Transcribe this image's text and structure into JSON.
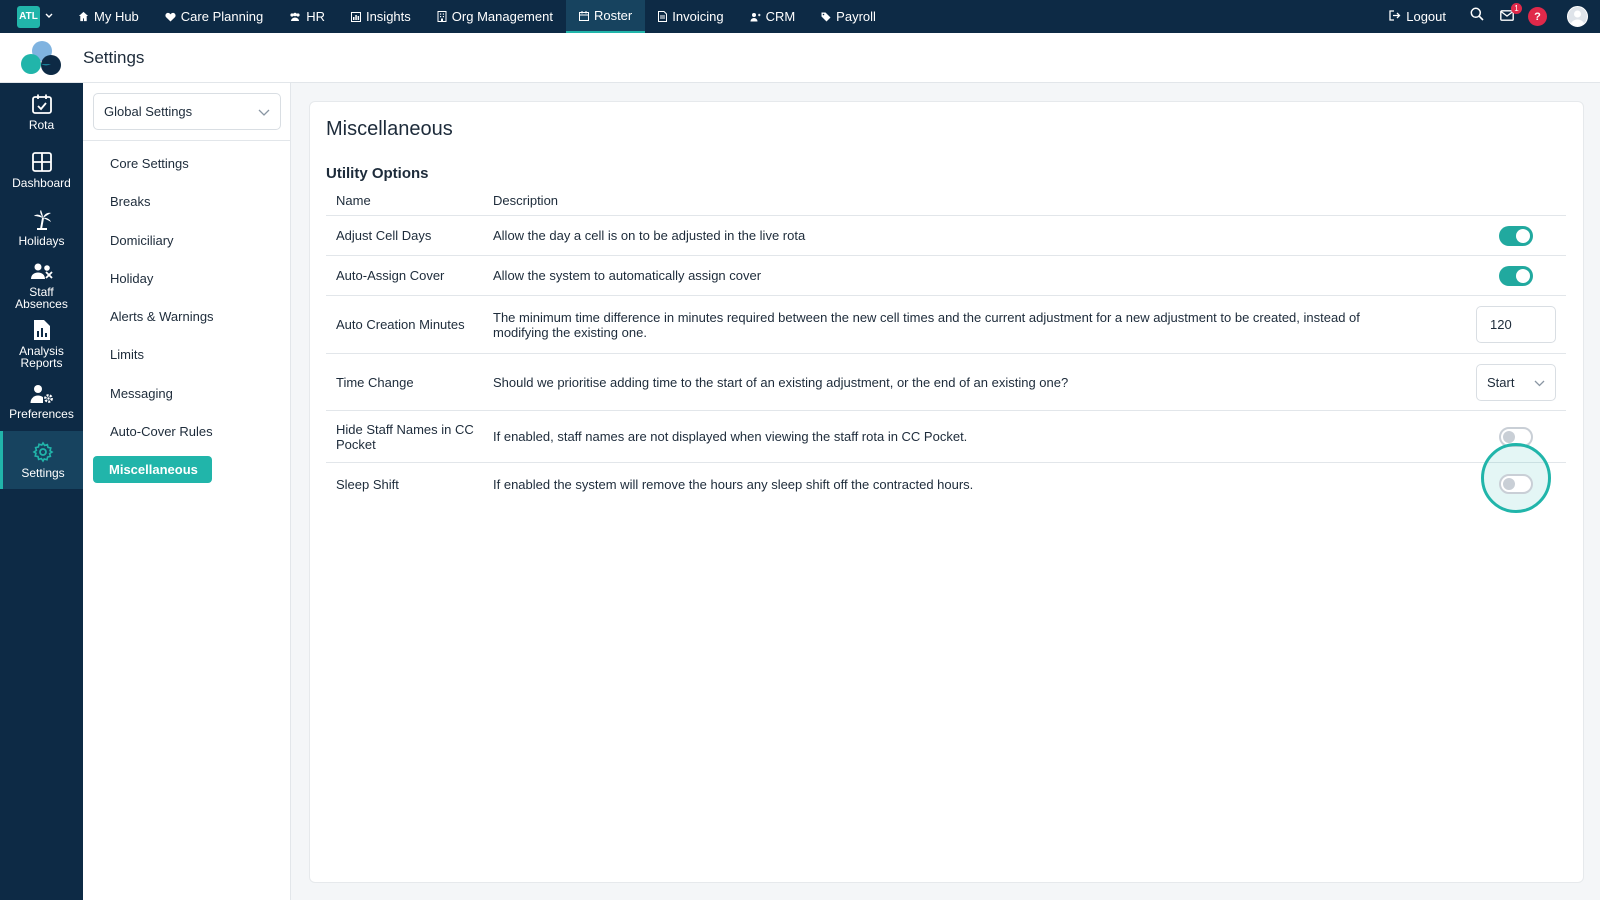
{
  "topnav": {
    "brand": "ATL",
    "items": [
      {
        "label": "My Hub",
        "icon": "home-icon"
      },
      {
        "label": "Care Planning",
        "icon": "heart-icon"
      },
      {
        "label": "HR",
        "icon": "people-icon"
      },
      {
        "label": "Insights",
        "icon": "chart-icon"
      },
      {
        "label": "Org Management",
        "icon": "building-icon"
      },
      {
        "label": "Roster",
        "icon": "calendar-icon",
        "active": true
      },
      {
        "label": "Invoicing",
        "icon": "document-icon"
      },
      {
        "label": "CRM",
        "icon": "contacts-icon"
      },
      {
        "label": "Payroll",
        "icon": "tag-icon"
      }
    ],
    "logout_label": "Logout",
    "notification_count": "1",
    "help_label": "?"
  },
  "subheader": {
    "title": "Settings"
  },
  "rail": {
    "items": [
      {
        "label": "Rota"
      },
      {
        "label": "Dashboard"
      },
      {
        "label": "Holidays"
      },
      {
        "label": "Staff Absences"
      },
      {
        "label": "Analysis Reports"
      },
      {
        "label": "Preferences"
      },
      {
        "label": "Settings",
        "active": true
      }
    ]
  },
  "sidebar": {
    "select_value": "Global Settings",
    "items": [
      {
        "label": "Core Settings"
      },
      {
        "label": "Breaks"
      },
      {
        "label": "Domiciliary"
      },
      {
        "label": "Holiday"
      },
      {
        "label": "Alerts & Warnings"
      },
      {
        "label": "Limits"
      },
      {
        "label": "Messaging"
      },
      {
        "label": "Auto-Cover Rules"
      },
      {
        "label": "Miscellaneous",
        "active": true
      }
    ]
  },
  "main": {
    "title": "Miscellaneous",
    "section": "Utility Options",
    "columns": {
      "name": "Name",
      "description": "Description"
    },
    "rows": [
      {
        "name": "Adjust Cell Days",
        "description": "Allow the day a cell is on to be adjusted in the live rota",
        "control": "toggle",
        "on": true
      },
      {
        "name": "Auto-Assign Cover",
        "description": "Allow the system to automatically assign cover",
        "control": "toggle",
        "on": true
      },
      {
        "name": "Auto Creation Minutes",
        "description": "The minimum time difference in minutes required between the new cell times and the current adjustment for a new adjustment to be created, instead of modifying the existing one.",
        "control": "number",
        "value": "120"
      },
      {
        "name": "Time Change",
        "description": "Should we prioritise adding time to the start of an existing adjustment, or the end of an existing one?",
        "control": "select",
        "value": "Start"
      },
      {
        "name": "Hide Staff Names in CC Pocket",
        "description": "If enabled, staff names are not displayed when viewing the staff rota in CC Pocket.",
        "control": "toggle",
        "on": false
      },
      {
        "name": "Sleep Shift",
        "description": "If enabled the system will remove the hours any sleep shift off the contracted hours.",
        "control": "toggle",
        "on": false,
        "focused": true
      }
    ]
  },
  "colors": {
    "accent": "#21b5aa",
    "nav_bg": "#0d2a45",
    "alert": "#e0294a"
  }
}
